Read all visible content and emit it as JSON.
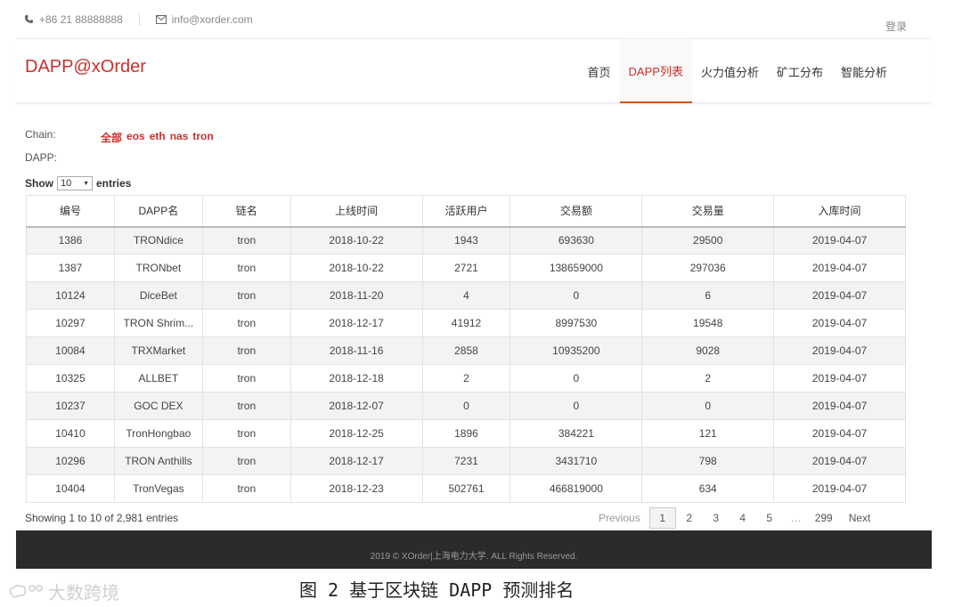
{
  "topbar": {
    "phone": "+86 21 88888888",
    "email": "info@xorder.com",
    "login": "登录"
  },
  "header": {
    "brand": "DAPP@xOrder",
    "nav": [
      "首页",
      "DAPP列表",
      "火力值分析",
      "矿工分布",
      "智能分析"
    ],
    "active_nav": "DAPP列表"
  },
  "filters": {
    "chain_label": "Chain:",
    "chain_options": [
      "全部",
      "eos",
      "eth",
      "nas",
      "tron"
    ],
    "dapp_label": "DAPP:"
  },
  "length": {
    "show": "Show",
    "value": "10",
    "entries": "entries"
  },
  "table": {
    "headers": [
      "编号",
      "DAPP名",
      "链名",
      "上线时间",
      "活跃用户",
      "交易额",
      "交易量",
      "入库时间"
    ],
    "rows": [
      [
        "1386",
        "TRONdice",
        "tron",
        "2018-10-22",
        "1943",
        "693630",
        "29500",
        "2019-04-07"
      ],
      [
        "1387",
        "TRONbet",
        "tron",
        "2018-10-22",
        "2721",
        "138659000",
        "297036",
        "2019-04-07"
      ],
      [
        "10124",
        "DiceBet",
        "tron",
        "2018-11-20",
        "4",
        "0",
        "6",
        "2019-04-07"
      ],
      [
        "10297",
        "TRON Shrim...",
        "tron",
        "2018-12-17",
        "41912",
        "8997530",
        "19548",
        "2019-04-07"
      ],
      [
        "10084",
        "TRXMarket",
        "tron",
        "2018-11-16",
        "2858",
        "10935200",
        "9028",
        "2019-04-07"
      ],
      [
        "10325",
        "ALLBET",
        "tron",
        "2018-12-18",
        "2",
        "0",
        "2",
        "2019-04-07"
      ],
      [
        "10237",
        "GOC DEX",
        "tron",
        "2018-12-07",
        "0",
        "0",
        "0",
        "2019-04-07"
      ],
      [
        "10410",
        "TronHongbao",
        "tron",
        "2018-12-25",
        "1896",
        "384221",
        "121",
        "2019-04-07"
      ],
      [
        "10296",
        "TRON Anthills",
        "tron",
        "2018-12-17",
        "7231",
        "3431710",
        "798",
        "2019-04-07"
      ],
      [
        "10404",
        "TronVegas",
        "tron",
        "2018-12-23",
        "502761",
        "466819000",
        "634",
        "2019-04-07"
      ]
    ]
  },
  "info": "Showing 1 to 10 of 2,981 entries",
  "pagination": {
    "previous": "Previous",
    "pages": [
      "1",
      "2",
      "3",
      "4",
      "5",
      "…",
      "299"
    ],
    "current": "1",
    "next": "Next"
  },
  "footer": "2019 © XOrder|上海电力大学. ALL Rights Reserved.",
  "caption": "图 2 基于区块链 DAPP 预测排名",
  "watermark": "大数跨境",
  "colors": {
    "accent": "#c9302c",
    "footer_bg": "#2b2b2b"
  },
  "icons": {
    "phone": "phone-icon",
    "email": "mail-icon",
    "select_caret": "caret-down-icon"
  }
}
